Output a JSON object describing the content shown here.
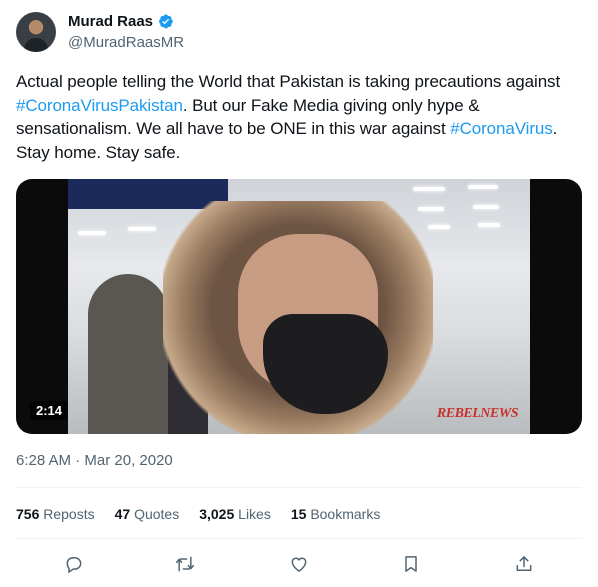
{
  "author": {
    "name": "Murad Raas",
    "handle": "@MuradRaasMR",
    "verified": true
  },
  "tweet": {
    "segments": [
      {
        "text": "Actual people telling the World that Pakistan is taking precautions against ",
        "type": "text"
      },
      {
        "text": "#CoronaVirusPakistan",
        "type": "hashtag"
      },
      {
        "text": ". But our Fake Media giving only hype & sensationalism. We all have to be ONE in this war against ",
        "type": "text"
      },
      {
        "text": "#CoronaVirus",
        "type": "hashtag"
      },
      {
        "text": ". Stay home. Stay safe.",
        "type": "text"
      }
    ]
  },
  "media": {
    "duration": "2:14",
    "watermark": "REBELNEWS"
  },
  "meta": {
    "time": "6:28 AM",
    "separator": "·",
    "date": "Mar 20, 2020"
  },
  "stats": {
    "reposts_count": "756",
    "reposts_label": "Reposts",
    "quotes_count": "47",
    "quotes_label": "Quotes",
    "likes_count": "3,025",
    "likes_label": "Likes",
    "bookmarks_count": "15",
    "bookmarks_label": "Bookmarks"
  },
  "actions": [
    {
      "name": "reply",
      "icon": "reply-icon"
    },
    {
      "name": "repost",
      "icon": "repost-icon"
    },
    {
      "name": "like",
      "icon": "heart-icon"
    },
    {
      "name": "bookmark",
      "icon": "bookmark-icon"
    },
    {
      "name": "share",
      "icon": "share-icon"
    }
  ],
  "colors": {
    "link": "#1d9bf0",
    "secondary_text": "#536471",
    "primary_text": "#0f1419"
  }
}
